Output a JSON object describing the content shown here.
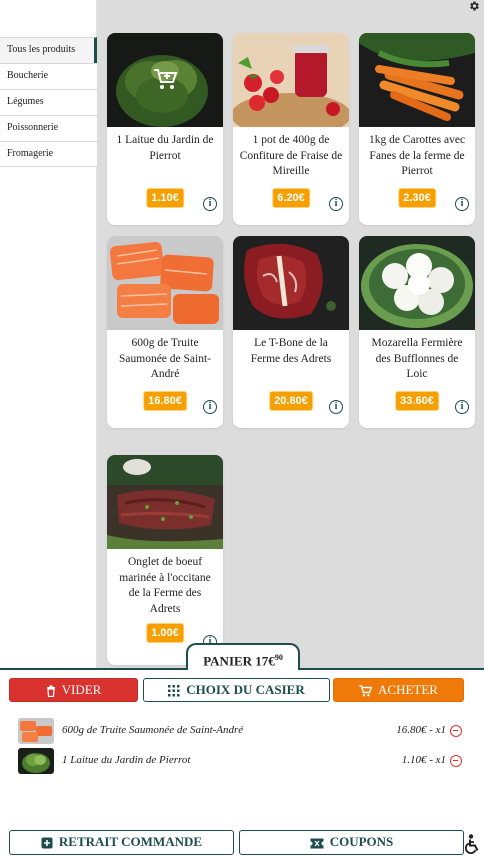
{
  "sidebar": {
    "items": [
      {
        "label": "Tous les produits",
        "active": true
      },
      {
        "label": "Boucherie",
        "active": false
      },
      {
        "label": "Légumes",
        "active": false
      },
      {
        "label": "Poissonnerie",
        "active": false
      },
      {
        "label": "Fromagerie",
        "active": false
      }
    ]
  },
  "products": [
    {
      "name": "1 Laitue du Jardin de Pierrot",
      "price": "1.10€",
      "image": "lettuce",
      "in_cart": true
    },
    {
      "name": "1 pot de 400g de Confiture de Fraise de Mireille",
      "price": "6.20€",
      "image": "strawberry-jam"
    },
    {
      "name": "1kg de Carottes avec Fanes de la ferme de Pierrot",
      "price": "2.30€",
      "image": "carrots"
    },
    {
      "name": "600g de Truite Saumonée de Saint-André",
      "price": "16.80€",
      "image": "trout"
    },
    {
      "name": "Le T-Bone de la Ferme des Adrets",
      "price": "20.80€",
      "image": "t-bone"
    },
    {
      "name": "Mozarella Fermière des Bufflonnes de Loic",
      "price": "33.60€",
      "image": "mozzarella"
    },
    {
      "name": "Onglet de boeuf marinée à l'occitane de la Ferme des Adrets",
      "price": "1.00€",
      "image": "onglet"
    }
  ],
  "cart": {
    "tab_label": "PANIER 17€",
    "tab_cents": "90",
    "actions": {
      "empty": "VIDER",
      "locker": "CHOIX DU CASIER",
      "buy": "ACHETER"
    },
    "lines": [
      {
        "label": "600g de Truite Saumonée de Saint-André",
        "amount": "16.80€ - x1",
        "image": "trout"
      },
      {
        "label": "1 Laitue du Jardin de Pierrot",
        "amount": "1.10€ - x1",
        "image": "lettuce"
      }
    ],
    "footer": {
      "pickup": "RETRAIT COMMANDE",
      "coupons": "COUPONS"
    }
  },
  "colors": {
    "accent": "#1d4d4f",
    "price": "#f5a000",
    "danger": "#d9322f",
    "buy": "#ef7a0a",
    "background": "#dcdcdc"
  },
  "icons": [
    "gear-icon",
    "info-icon",
    "cart-add-icon",
    "trash-icon",
    "grid-dots-icon",
    "cart-icon",
    "store-icon",
    "ticket-icon",
    "accessibility-icon",
    "remove-icon"
  ]
}
